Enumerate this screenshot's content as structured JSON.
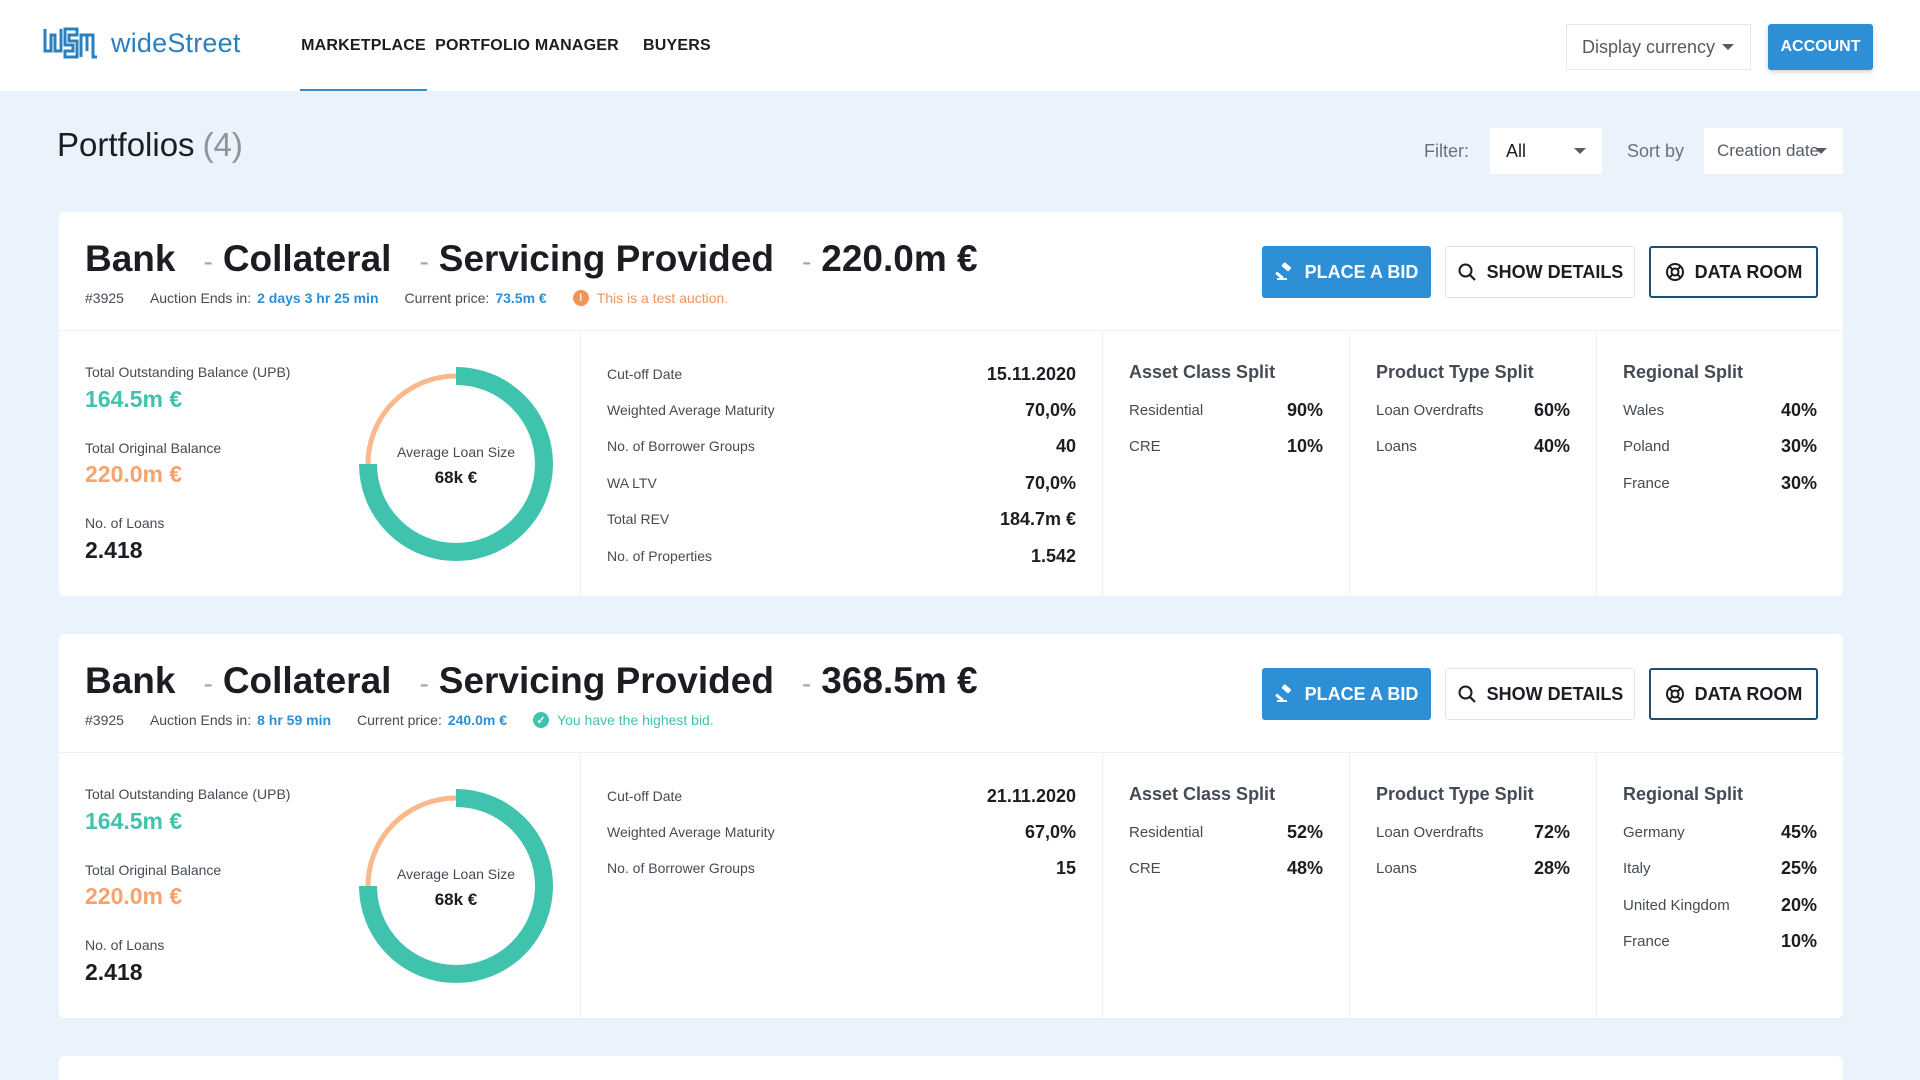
{
  "brand": {
    "name": "wideStreet"
  },
  "nav": {
    "items": [
      {
        "label": "MARKETPLACE",
        "active": true
      },
      {
        "label": "PORTFOLIO MANAGER",
        "active": false
      },
      {
        "label": "BUYERS",
        "active": false
      }
    ],
    "currency_select": "Display currency",
    "account_label": "ACCOUNT"
  },
  "page": {
    "title": "Portfolios",
    "count": "(4)",
    "filter_label": "Filter:",
    "filter_value": "All",
    "sort_label": "Sort by",
    "sort_value": "Creation date"
  },
  "labels": {
    "sep": "-",
    "auction_ends": "Auction Ends in:",
    "current_price": "Current price:",
    "place_bid": "PLACE A BID",
    "show_details": "SHOW DETAILS",
    "data_room": "DATA ROOM",
    "upb": "Total Outstanding Balance (UPB)",
    "original_balance": "Total Original Balance",
    "num_loans": "No. of Loans",
    "avg_loan_size": "Average Loan Size",
    "asset_split": "Asset Class Split",
    "product_split": "Product Type Split",
    "regional_split": "Regional Split"
  },
  "colors": {
    "accent": "#2d8fd5",
    "teal": "#3fc3ad",
    "orange": "#f7a36d",
    "warn": "#f3935a"
  },
  "portfolios": [
    {
      "bank": "Bank",
      "collateral": "Collateral",
      "servicing": "Servicing Provided",
      "amount": "220.0m €",
      "id": "#3925",
      "auction_ends": "2 days 3 hr 25 min",
      "current_price": "73.5m €",
      "notice": "This is a test auction.",
      "notice_type": "warning",
      "notice_icon": "alert-icon",
      "upb": "164.5m €",
      "original_balance": "220.0m €",
      "num_loans": "2.418",
      "avg_loan_size": "68k €",
      "metrics": [
        {
          "key": "Cut-off Date",
          "value": "15.11.2020"
        },
        {
          "key": "Weighted Average Maturity",
          "value": "70,0%"
        },
        {
          "key": "No. of Borrower Groups",
          "value": "40"
        },
        {
          "key": "WA LTV",
          "value": "70,0%"
        },
        {
          "key": "Total REV",
          "value": "184.7m €"
        },
        {
          "key": "No. of Properties",
          "value": "1.542"
        }
      ],
      "asset_split": [
        {
          "key": "Residential",
          "value": "90%"
        },
        {
          "key": "CRE",
          "value": "10%"
        }
      ],
      "product_split": [
        {
          "key": "Loan Overdrafts",
          "value": "60%"
        },
        {
          "key": "Loans",
          "value": "40%"
        }
      ],
      "regional_split": [
        {
          "key": "Wales",
          "value": "40%"
        },
        {
          "key": "Poland",
          "value": "30%"
        },
        {
          "key": "France",
          "value": "30%"
        }
      ]
    },
    {
      "bank": "Bank",
      "collateral": "Collateral",
      "servicing": "Servicing Provided",
      "amount": "368.5m €",
      "id": "#3925",
      "auction_ends": "8 hr 59 min",
      "current_price": "240.0m €",
      "notice": "You have the highest bid.",
      "notice_type": "success",
      "notice_icon": "check-circle-icon",
      "upb": "164.5m €",
      "original_balance": "220.0m €",
      "num_loans": "2.418",
      "avg_loan_size": "68k €",
      "metrics": [
        {
          "key": "Cut-off Date",
          "value": "21.11.2020"
        },
        {
          "key": "Weighted Average Maturity",
          "value": "67,0%"
        },
        {
          "key": "No. of Borrower Groups",
          "value": "15"
        }
      ],
      "asset_split": [
        {
          "key": "Residential",
          "value": "52%"
        },
        {
          "key": "CRE",
          "value": "48%"
        }
      ],
      "product_split": [
        {
          "key": "Loan Overdrafts",
          "value": "72%"
        },
        {
          "key": "Loans",
          "value": "28%"
        }
      ],
      "regional_split": [
        {
          "key": "Germany",
          "value": "45%"
        },
        {
          "key": "Italy",
          "value": "25%"
        },
        {
          "key": "United Kingdom",
          "value": "20%"
        },
        {
          "key": "France",
          "value": "10%"
        }
      ]
    }
  ]
}
